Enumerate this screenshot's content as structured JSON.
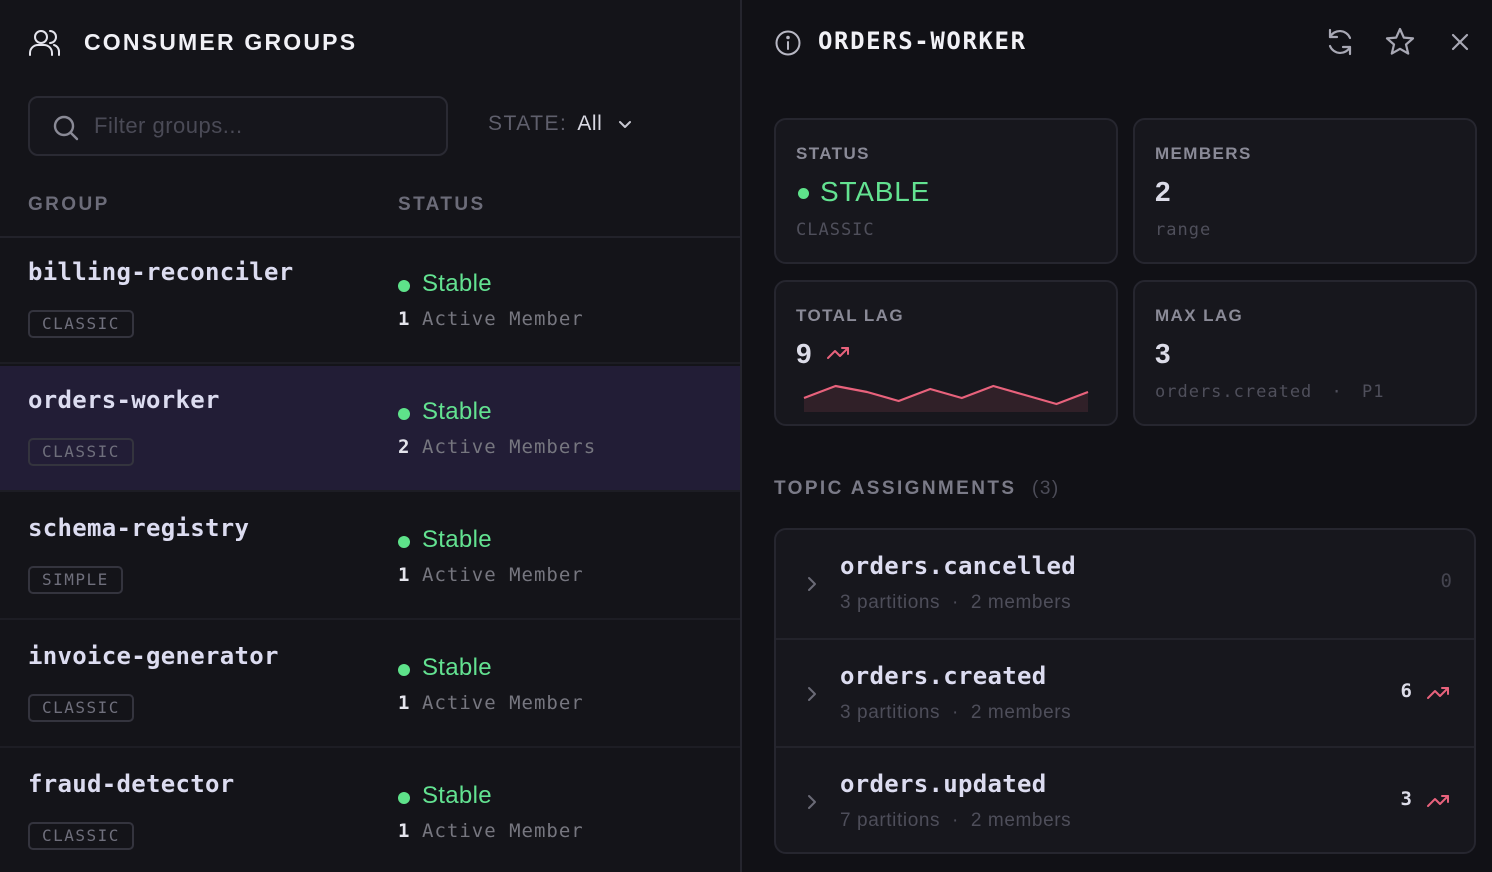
{
  "left": {
    "title": "CONSUMER GROUPS",
    "search": {
      "placeholder": "Filter groups...",
      "value": ""
    },
    "state_filter": {
      "label": "STATE:",
      "value": "All"
    },
    "columns": {
      "group": "GROUP",
      "status": "STATUS"
    },
    "groups": [
      {
        "name": "billing-reconciler",
        "type": "CLASSIC",
        "status": "Stable",
        "member_count": "1",
        "member_label": "Active Member",
        "selected": false
      },
      {
        "name": "orders-worker",
        "type": "CLASSIC",
        "status": "Stable",
        "member_count": "2",
        "member_label": "Active Members",
        "selected": true
      },
      {
        "name": "schema-registry",
        "type": "SIMPLE",
        "status": "Stable",
        "member_count": "1",
        "member_label": "Active Member",
        "selected": false
      },
      {
        "name": "invoice-generator",
        "type": "CLASSIC",
        "status": "Stable",
        "member_count": "1",
        "member_label": "Active Member",
        "selected": false
      },
      {
        "name": "fraud-detector",
        "type": "CLASSIC",
        "status": "Stable",
        "member_count": "1",
        "member_label": "Active Member",
        "selected": false
      }
    ]
  },
  "detail": {
    "title": "ORDERS-WORKER",
    "cards": {
      "status": {
        "label": "STATUS",
        "value": "STABLE",
        "sub": "CLASSIC"
      },
      "members": {
        "label": "MEMBERS",
        "value": "2",
        "sub": "range"
      },
      "total_lag": {
        "label": "TOTAL LAG",
        "value": "9",
        "sparkline": [
          2,
          6,
          4,
          1,
          5,
          2,
          6,
          3,
          0,
          4
        ]
      },
      "max_lag": {
        "label": "MAX LAG",
        "value": "3",
        "sub_topic": "orders.created",
        "sub_sep": "·",
        "sub_partition": "P1"
      }
    },
    "topic_assignments": {
      "title": "TOPIC ASSIGNMENTS",
      "count": "(3)",
      "items": [
        {
          "name": "orders.cancelled",
          "partitions": "3 partitions",
          "members": "2 members",
          "sep": "·",
          "lag": "0",
          "trending": false
        },
        {
          "name": "orders.created",
          "partitions": "3 partitions",
          "members": "2 members",
          "sep": "·",
          "lag": "6",
          "trending": true
        },
        {
          "name": "orders.updated",
          "partitions": "7 partitions",
          "members": "2 members",
          "sep": "·",
          "lag": "3",
          "trending": true
        }
      ]
    }
  },
  "colors": {
    "accent_green": "#63e291",
    "trend_red": "#e8627c",
    "selected_row": "#221d36"
  },
  "icons": [
    "users-icon",
    "search-icon",
    "chevron-down-icon",
    "info-icon",
    "refresh-icon",
    "star-icon",
    "close-icon",
    "trending-up-icon",
    "chevron-right-icon"
  ]
}
